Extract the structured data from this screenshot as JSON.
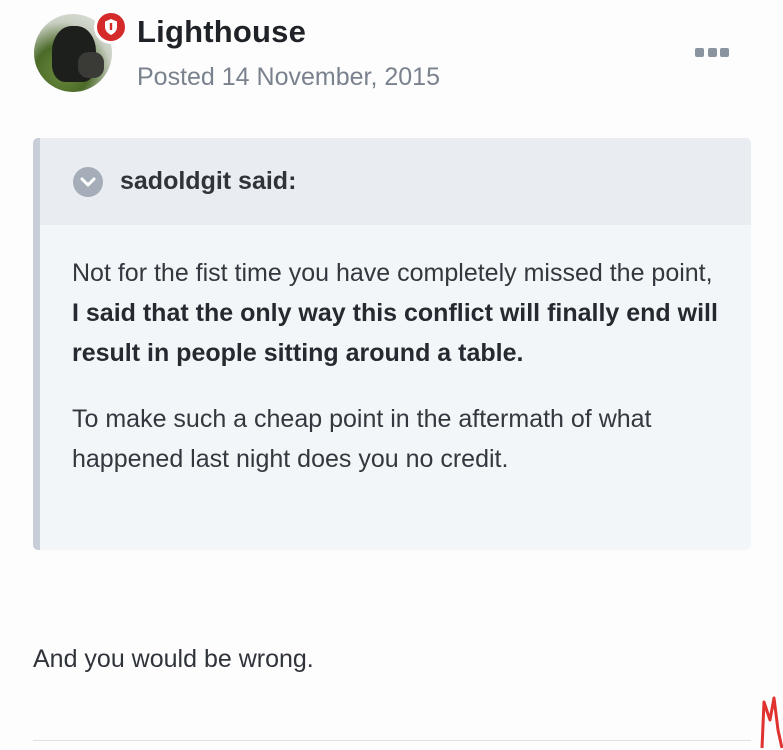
{
  "post": {
    "author": "Lighthouse",
    "posted": "Posted 14 November, 2015"
  },
  "quote": {
    "citation": "sadoldgit said:",
    "p1_start": "Not for the fist time you have completely missed the point, ",
    "p1_bold": "I said that the only way this conflict will finally end will result in people sitting around a table.",
    "p2": "To make such a cheap point in the aftermath of what happened last night does you no credit."
  },
  "reply": {
    "text": "And you would be wrong."
  },
  "colors": {
    "badge": "#d42a2a",
    "quote_bg": "#f3f6f9",
    "quote_header_bg": "#e9edf1",
    "quote_border": "#c7ced7",
    "muted_text": "#7a828d"
  },
  "icons": {
    "badge": "shield-icon",
    "more": "ellipsis-icon",
    "quote_toggle": "chevron-down-icon"
  }
}
